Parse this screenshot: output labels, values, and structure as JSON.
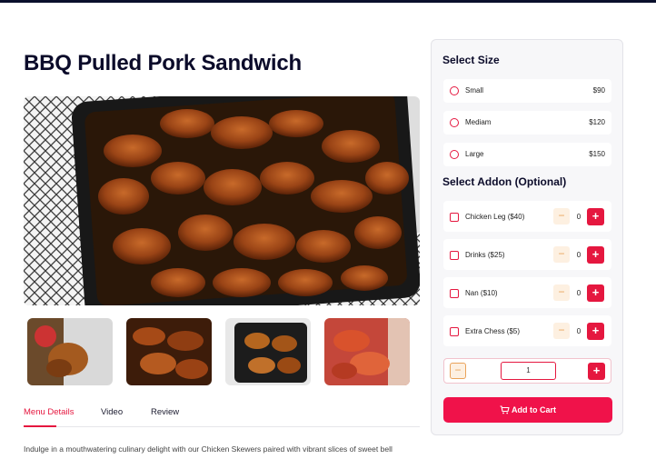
{
  "product": {
    "title": "BBQ Pulled Pork Sandwich"
  },
  "tabs": [
    {
      "label": "Menu Details",
      "active": true
    },
    {
      "label": "Video",
      "active": false
    },
    {
      "label": "Review",
      "active": false
    }
  ],
  "description": "Indulge in a mouthwatering culinary delight with our Chicken Skewers paired with vibrant slices of sweet bell",
  "size": {
    "heading": "Select Size",
    "options": [
      {
        "label": "Small",
        "price": "$90"
      },
      {
        "label": "Mediam",
        "price": "$120"
      },
      {
        "label": "Large",
        "price": "$150"
      }
    ]
  },
  "addon": {
    "heading": "Select Addon (Optional)",
    "items": [
      {
        "label": "Chicken Leg ($40)",
        "qty": "0"
      },
      {
        "label": "Drinks ($25)",
        "qty": "0"
      },
      {
        "label": "Nan ($10)",
        "qty": "0"
      },
      {
        "label": "Extra Chess ($5)",
        "qty": "0"
      }
    ],
    "minus_symbol": "−",
    "plus_symbol": "+"
  },
  "quantity": {
    "value": "1",
    "minus_symbol": "−",
    "plus_symbol": "+"
  },
  "cart": {
    "label": "Add to Cart",
    "icon": "cart-icon"
  },
  "colors": {
    "accent": "#e5173f",
    "cart": "#f0124a",
    "minus_bg": "#fdf0e1"
  }
}
